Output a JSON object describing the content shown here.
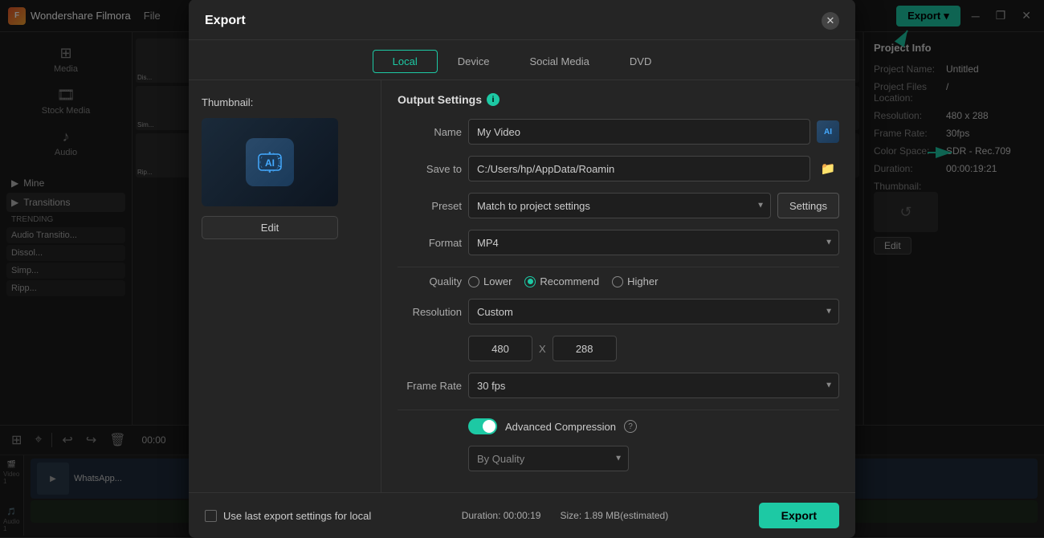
{
  "app": {
    "name": "Wondershare Filmora",
    "menu": [
      "File"
    ]
  },
  "topbar": {
    "export_label": "Export",
    "export_dropdown": "▾"
  },
  "window_controls": {
    "minimize": "─",
    "maximize": "❐",
    "close": "✕"
  },
  "sidebar": {
    "items": [
      {
        "icon": "⊞",
        "label": "Media"
      },
      {
        "icon": "🎞",
        "label": "Stock Media"
      },
      {
        "icon": "♪",
        "label": "Audio"
      }
    ],
    "nav": [
      {
        "label": "Mine",
        "active": false
      },
      {
        "label": "Transitions",
        "active": true
      }
    ],
    "trending_label": "TRENDING",
    "transition_list": [
      {
        "label": "Audio Transitio..."
      },
      {
        "label": "Dissol..."
      },
      {
        "label": "Simp..."
      },
      {
        "label": "Ripp..."
      }
    ]
  },
  "right_panel": {
    "title": "Project Info",
    "fields": [
      {
        "label": "Project Name:",
        "value": "Untitled"
      },
      {
        "label": "Project Files Location:",
        "value": "/"
      },
      {
        "label": "Resolution:",
        "value": "480 x 288"
      },
      {
        "label": "Frame Rate:",
        "value": "30fps"
      },
      {
        "label": "Color Space:",
        "value": "SDR - Rec.709"
      },
      {
        "label": "Duration:",
        "value": "00:00:19:21"
      },
      {
        "label": "Thumbnail:",
        "value": ""
      }
    ],
    "edit_btn": "Edit"
  },
  "dialog": {
    "title": "Export",
    "close_icon": "✕",
    "tabs": [
      {
        "label": "Local",
        "active": true
      },
      {
        "label": "Device",
        "active": false
      },
      {
        "label": "Social Media",
        "active": false
      },
      {
        "label": "DVD",
        "active": false
      }
    ],
    "thumbnail_label": "Thumbnail:",
    "edit_btn": "Edit",
    "output_settings_label": "Output Settings",
    "form": {
      "name_label": "Name",
      "name_value": "My Video",
      "save_to_label": "Save to",
      "save_to_value": "C:/Users/hp/AppData/Roamin",
      "preset_label": "Preset",
      "preset_value": "Match to project settings",
      "settings_btn": "Settings",
      "format_label": "Format",
      "format_value": "MP4",
      "quality_label": "Quality",
      "quality_options": [
        {
          "label": "Lower",
          "selected": false
        },
        {
          "label": "Recommend",
          "selected": true
        },
        {
          "label": "Higher",
          "selected": false
        }
      ],
      "resolution_label": "Resolution",
      "resolution_value": "Custom",
      "res_width": "480",
      "res_x": "X",
      "res_height": "288",
      "frame_rate_label": "Frame Rate",
      "frame_rate_value": "30 fps",
      "advanced_compression_label": "Advanced Compression",
      "by_quality_value": "By Quality"
    },
    "footer": {
      "checkbox_label": "Use last export settings for local",
      "duration_label": "Duration: 00:00:19",
      "size_label": "Size: 1.89 MB(estimated)",
      "export_btn": "Export"
    }
  },
  "timeline": {
    "time_display": "00:00",
    "toolbar_icons": [
      "⊞",
      "⌖",
      "↩",
      "↪",
      "🗑"
    ],
    "track_icons": [
      "🎬",
      "🎵"
    ],
    "video_label": "Video 1",
    "audio_label": "Audio 1",
    "video_clip": "WhatsApp..."
  },
  "arrows": {
    "color": "#1dc9a4"
  }
}
